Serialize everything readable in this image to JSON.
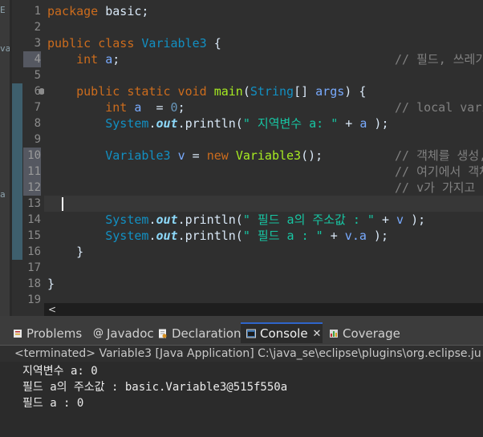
{
  "sidebar_fragments": [
    "E",
    "va",
    "a"
  ],
  "line_numbers": [
    "1",
    "2",
    "3",
    "4",
    "5",
    "6",
    "7",
    "8",
    "9",
    "10",
    "11",
    "12",
    "13",
    "14",
    "15",
    "16",
    "17",
    "18",
    "19"
  ],
  "code": {
    "l1": {
      "kw": "package",
      "rest": " basic;"
    },
    "l3": {
      "kw": "public class",
      "cls": "Variable3",
      "rest": " {"
    },
    "l4": {
      "ty": "int",
      "var": "a",
      "rest": ";",
      "comment": "// 필드, 쓰레기값"
    },
    "l6": {
      "kw": "public static void",
      "fn": "main",
      "p1": "(",
      "ty": "String",
      "p2": "[] ",
      "var": "args",
      "p3": ") {"
    },
    "l7": {
      "ty": "int",
      "var": "a",
      "eq": "  = ",
      "num": "0",
      "rest": ";",
      "comment": "// local vari"
    },
    "l8": {
      "cls": "System",
      "dot1": ".",
      "st": "out",
      "dot2": ".",
      "method": "println(",
      "str": "\" 지역변수 a: \"",
      "plus": " + ",
      "var": "a",
      "end": " );"
    },
    "l10": {
      "cls": "Variable3",
      "var": "v",
      "eq": " = ",
      "kw": "new",
      "cls2": "Variable3",
      "end": "();",
      "comment": "// 객체를 생성, "
    },
    "l11": {
      "comment": "// 여기에서 객체에"
    },
    "l12": {
      "comment": "// v가 가지고 있"
    },
    "l14": {
      "cls": "System",
      "dot1": ".",
      "st": "out",
      "dot2": ".",
      "method": "println(",
      "str": "\" 필드 a의 주소값 : \"",
      "plus": " + ",
      "var": "v",
      "end": " );"
    },
    "l15": {
      "cls": "System",
      "dot1": ".",
      "st": "out",
      "dot2": ".",
      "method": "println(",
      "str": "\" 필드 a : \"",
      "plus": " + ",
      "var": "v.a",
      "end": " );"
    },
    "l16": "}",
    "l18": "}"
  },
  "scroll_left": "<",
  "tabs": [
    {
      "label": "Problems",
      "icon": "problems-icon"
    },
    {
      "label": "Javadoc",
      "icon": "javadoc-icon"
    },
    {
      "label": "Declaration",
      "icon": "declaration-icon"
    },
    {
      "label": "Console",
      "icon": "console-icon",
      "active": true,
      "close": "✕"
    },
    {
      "label": "Coverage",
      "icon": "coverage-icon"
    }
  ],
  "console": {
    "header": "<terminated> Variable3 [Java Application] C:\\java_se\\eclipse\\plugins\\org.eclipse.ju",
    "output": [
      "지역변수 a: 0",
      "필드 a의 주소값 : basic.Variable3@515f550a",
      "필드 a : 0"
    ]
  },
  "colors": {
    "editor_bg": "#2f2f2f",
    "keyword": "#cc6c1d",
    "type": "#1290c3",
    "method": "#a7ec21",
    "variable": "#79abff",
    "string": "#17c6a3",
    "comment": "#808080",
    "active_tab_accent": "#2f65ca"
  }
}
